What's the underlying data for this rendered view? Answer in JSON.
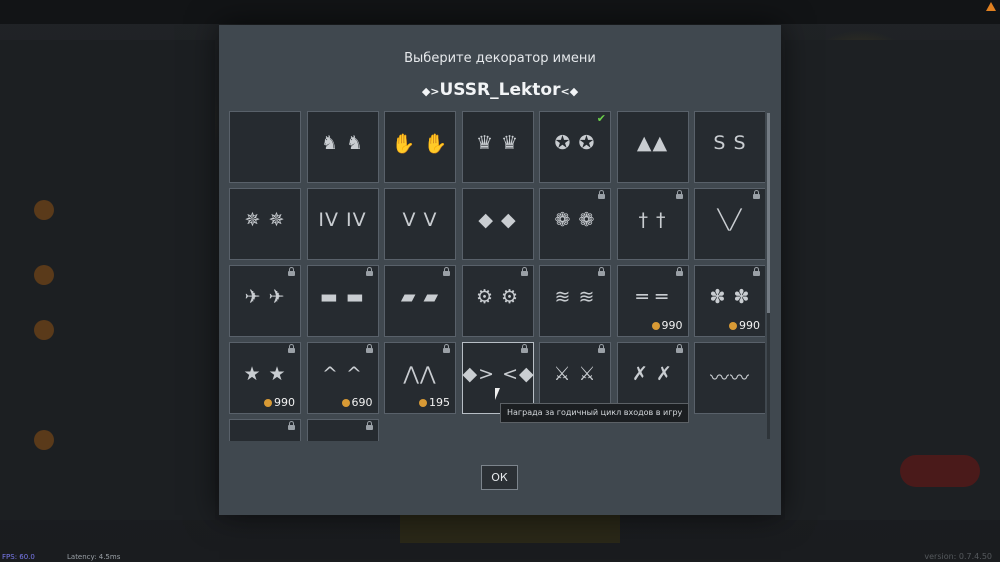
{
  "background": {
    "fps": "FPS: 60.0",
    "latency": "Latency: 4.5ms",
    "version": "version: 0.7.4.50"
  },
  "modal": {
    "title": "Выберите декоратор имени",
    "player_name": "USSR_Lektor",
    "decor_left": "◆>",
    "decor_right": "<◆",
    "ok_label": "ОК",
    "tooltip": "Награда за годичный цикл входов в игру"
  },
  "tiles": [
    {
      "symbol": "",
      "locked": false
    },
    {
      "symbol": "♞ ♞",
      "locked": false
    },
    {
      "symbol": "✋ ✋",
      "locked": false
    },
    {
      "symbol": "♛ ♛",
      "locked": false
    },
    {
      "symbol": "✪ ✪",
      "locked": false,
      "selected": true
    },
    {
      "symbol": "▲▲",
      "locked": false
    },
    {
      "symbol": "S S",
      "locked": false
    },
    {
      "symbol": "✵ ✵",
      "locked": false
    },
    {
      "symbol": "IV IV",
      "locked": false
    },
    {
      "symbol": "V V",
      "locked": false
    },
    {
      "symbol": "◆ ◆",
      "locked": false
    },
    {
      "symbol": "❁ ❁",
      "locked": true
    },
    {
      "symbol": "† †",
      "locked": true
    },
    {
      "symbol": "╲╱",
      "locked": true
    },
    {
      "symbol": "✈ ✈",
      "locked": true
    },
    {
      "symbol": "▬ ▬",
      "locked": true
    },
    {
      "symbol": "▰ ▰",
      "locked": true
    },
    {
      "symbol": "⚙ ⚙",
      "locked": true
    },
    {
      "symbol": "≋ ≋",
      "locked": true
    },
    {
      "symbol": "═ ═",
      "locked": true,
      "price": "990"
    },
    {
      "symbol": "✽ ✽",
      "locked": true,
      "price": "990"
    },
    {
      "symbol": "★ ★",
      "locked": true,
      "price": "990"
    },
    {
      "symbol": "^ ^",
      "locked": true,
      "price": "690"
    },
    {
      "symbol": "⋀⋀",
      "locked": true,
      "price": "195"
    },
    {
      "symbol": "◆> <◆",
      "locked": true,
      "highlighted": true
    },
    {
      "symbol": "⚔ ⚔",
      "locked": true
    },
    {
      "symbol": "✗ ✗",
      "locked": true
    },
    {
      "symbol": "〰〰",
      "locked": false
    },
    {
      "symbol": "",
      "locked": true
    },
    {
      "symbol": "",
      "locked": true
    }
  ],
  "colors": {
    "modal_bg": "#40484f",
    "tile_bg": "#262b30",
    "check": "#6bd14a",
    "coin": "#d89a35"
  }
}
